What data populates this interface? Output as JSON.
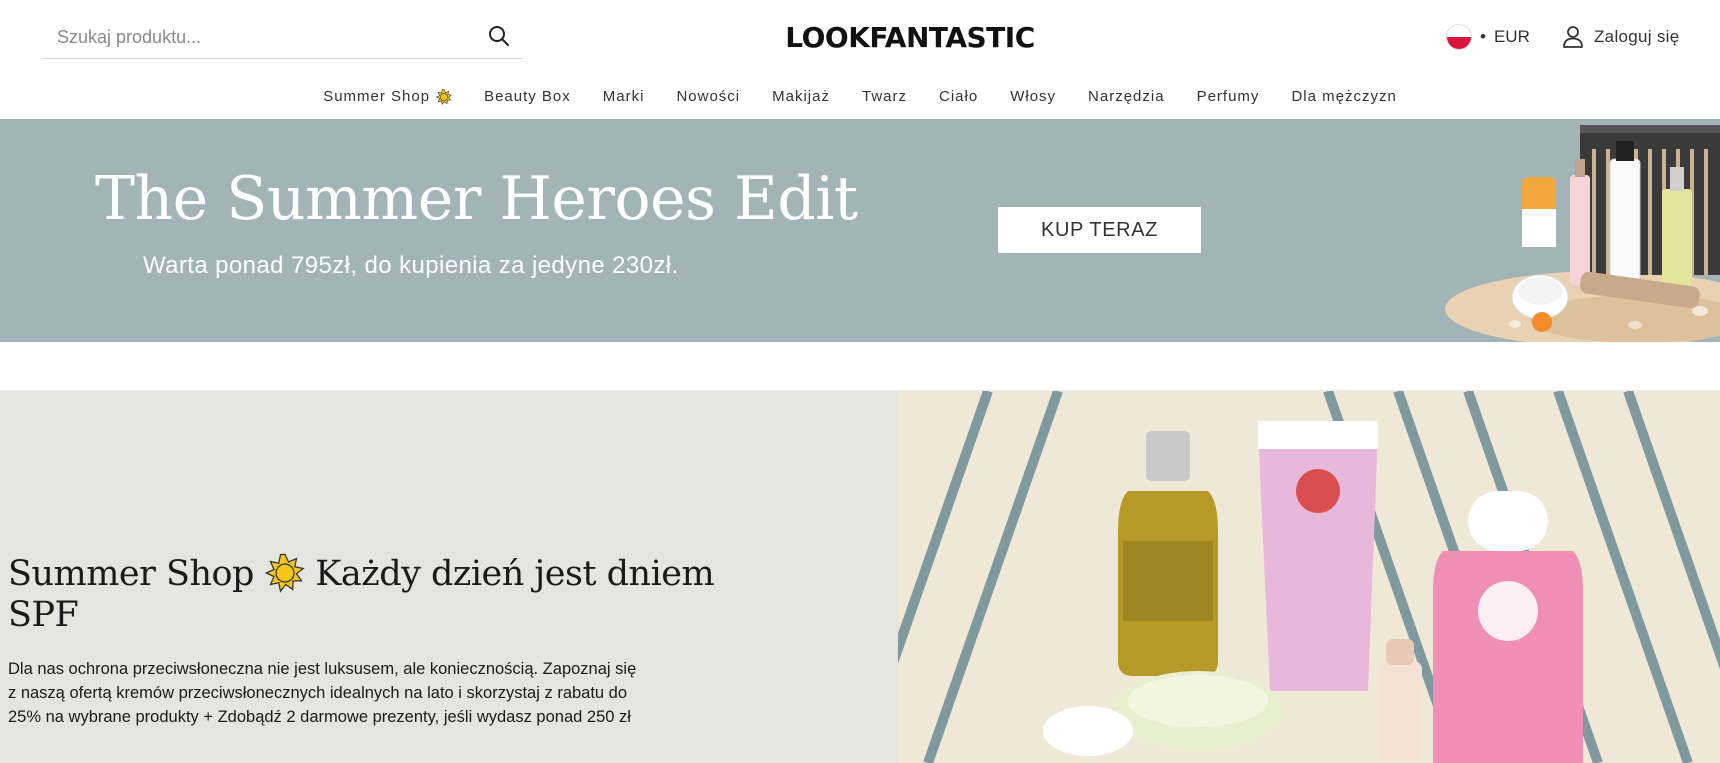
{
  "header": {
    "search_placeholder": "Szukaj produktu...",
    "logo": "LOOKFANTASTIC",
    "currency_separator": "•",
    "currency": "EUR",
    "login_label": "Zaloguj się"
  },
  "nav": {
    "items": [
      {
        "label": "Summer Shop",
        "icon": "sun-icon"
      },
      {
        "label": "Beauty Box"
      },
      {
        "label": "Marki"
      },
      {
        "label": "Nowości"
      },
      {
        "label": "Makijaż"
      },
      {
        "label": "Twarz"
      },
      {
        "label": "Ciało"
      },
      {
        "label": "Włosy"
      },
      {
        "label": "Narzędzia"
      },
      {
        "label": "Perfumy"
      },
      {
        "label": "Dla mężczyzn"
      }
    ]
  },
  "hero": {
    "title": "The Summer Heroes Edit",
    "subtitle": "Warta ponad 795zł, do kupienia za jedyne 230zł.",
    "cta_label": "KUP TERAZ"
  },
  "summer": {
    "title_line1": "Summer Shop",
    "title_line1_after": "Każdy dzień jest dniem",
    "title_line2": "SPF",
    "body": "Dla nas ochrona przeciwsłoneczna nie jest luksusem, ale koniecznością. Zapoznaj się z naszą ofertą kremów przeciwsłonecznych idealnych na lato i skorzystaj z rabatu do 25% na wybrane produkty + Zdobądź 2 darmowe prezenty, jeśli wydasz ponad 250 zł"
  },
  "colors": {
    "hero_bg": "#a2b4b6",
    "summer_left_bg": "#e4e5de",
    "accent_sun": "#f5c518"
  }
}
